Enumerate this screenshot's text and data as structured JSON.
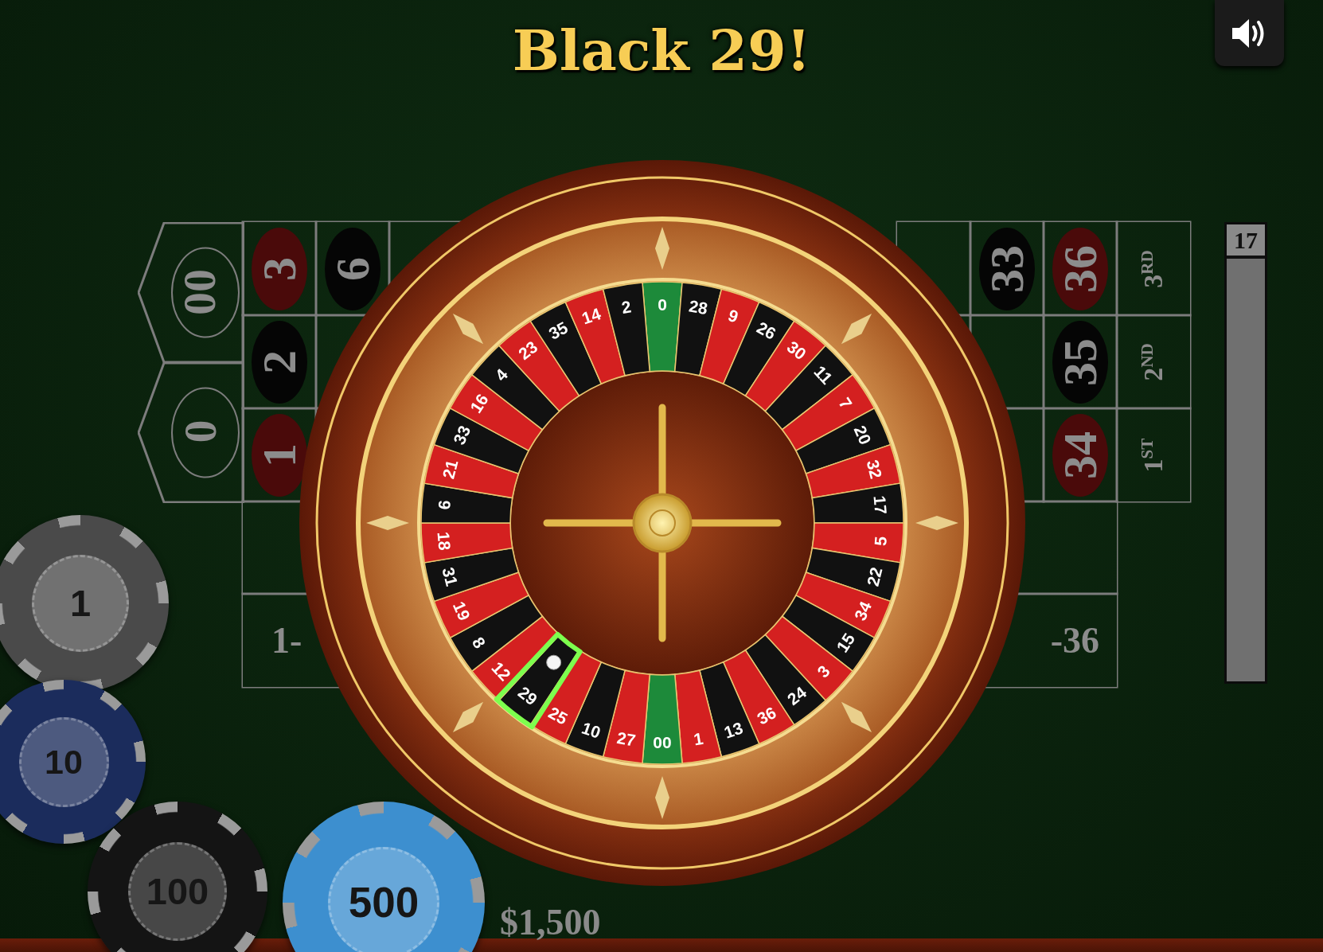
{
  "result_banner": "Black 29!",
  "sound_on": true,
  "table_left": {
    "zeros": [
      {
        "label": "00"
      },
      {
        "label": "0"
      }
    ],
    "numbers": [
      {
        "label": "3",
        "color": "#4a0a0a"
      },
      {
        "label": "6",
        "color": "#050505"
      },
      {
        "label": "2",
        "color": "#050505"
      },
      {
        "label": "1",
        "color": "#4a0a0a"
      }
    ],
    "outside": "1-"
  },
  "table_right": {
    "numbers": [
      {
        "label": "33",
        "color": "#050505"
      },
      {
        "label": "36",
        "color": "#4a0a0a"
      },
      {
        "label": "35",
        "color": "#050505"
      },
      {
        "label": "34",
        "color": "#4a0a0a"
      }
    ],
    "columns": [
      "3$^{RD}$",
      "2$^{ND}$",
      "1$^{ST}$"
    ],
    "outside": "-36"
  },
  "history": {
    "label": "17"
  },
  "wheel": {
    "pockets": [
      {
        "label": "0",
        "color": "#1d8a3a",
        "selected": false
      },
      {
        "label": "28",
        "color": "#111111",
        "selected": false
      },
      {
        "label": "9",
        "color": "#d42020",
        "selected": false
      },
      {
        "label": "26",
        "color": "#111111",
        "selected": false
      },
      {
        "label": "30",
        "color": "#d42020",
        "selected": false
      },
      {
        "label": "11",
        "color": "#111111",
        "selected": false
      },
      {
        "label": "7",
        "color": "#d42020",
        "selected": false
      },
      {
        "label": "20",
        "color": "#111111",
        "selected": false
      },
      {
        "label": "32",
        "color": "#d42020",
        "selected": false
      },
      {
        "label": "17",
        "color": "#111111",
        "selected": false
      },
      {
        "label": "5",
        "color": "#d42020",
        "selected": false
      },
      {
        "label": "22",
        "color": "#111111",
        "selected": false
      },
      {
        "label": "34",
        "color": "#d42020",
        "selected": false
      },
      {
        "label": "15",
        "color": "#111111",
        "selected": false
      },
      {
        "label": "3",
        "color": "#d42020",
        "selected": false
      },
      {
        "label": "24",
        "color": "#111111",
        "selected": false
      },
      {
        "label": "36",
        "color": "#d42020",
        "selected": false
      },
      {
        "label": "13",
        "color": "#111111",
        "selected": false
      },
      {
        "label": "1",
        "color": "#d42020",
        "selected": false
      },
      {
        "label": "00",
        "color": "#1d8a3a",
        "selected": false
      },
      {
        "label": "27",
        "color": "#d42020",
        "selected": false
      },
      {
        "label": "10",
        "color": "#111111",
        "selected": false
      },
      {
        "label": "25",
        "color": "#d42020",
        "selected": false
      },
      {
        "label": "29",
        "color": "#111111",
        "selected": true
      },
      {
        "label": "12",
        "color": "#d42020",
        "selected": false
      },
      {
        "label": "8",
        "color": "#111111",
        "selected": false
      },
      {
        "label": "19",
        "color": "#d42020",
        "selected": false
      },
      {
        "label": "31",
        "color": "#111111",
        "selected": false
      },
      {
        "label": "18",
        "color": "#d42020",
        "selected": false
      },
      {
        "label": "6",
        "color": "#111111",
        "selected": false
      },
      {
        "label": "21",
        "color": "#d42020",
        "selected": false
      },
      {
        "label": "33",
        "color": "#111111",
        "selected": false
      },
      {
        "label": "16",
        "color": "#d42020",
        "selected": false
      },
      {
        "label": "4",
        "color": "#111111",
        "selected": false
      },
      {
        "label": "23",
        "color": "#d42020",
        "selected": false
      },
      {
        "label": "35",
        "color": "#111111",
        "selected": false
      },
      {
        "label": "14",
        "color": "#d42020",
        "selected": false
      },
      {
        "label": "2",
        "color": "#111111",
        "selected": false
      }
    ]
  },
  "chips": [
    {
      "label": "1",
      "color": "#4a4a4a"
    },
    {
      "label": "10",
      "color": "#1b2c5c"
    },
    {
      "label": "100",
      "color": "#141414"
    },
    {
      "label": "500",
      "color": "#3d8fcf"
    }
  ],
  "balance": "$1,500"
}
